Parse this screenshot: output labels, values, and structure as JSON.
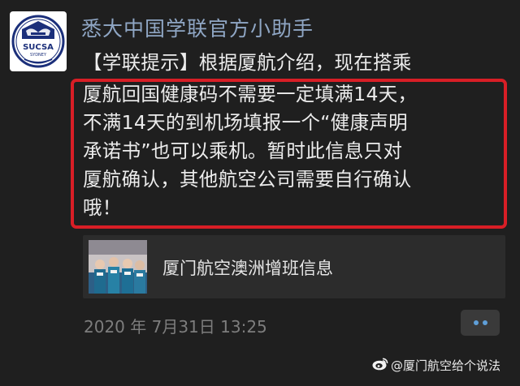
{
  "message": {
    "sender_name": "悉大中国学联官方小助手",
    "avatar": {
      "icon": "sucsa-logo-icon",
      "logo_text": "SUCSA",
      "logo_subtext": "SYDNEY"
    },
    "body_lines": [
      "【学联提示】根据厦航介绍，现在搭乘",
      "厦航回国健康码不需要一定填满14天，",
      "不满14天的到机场填报一个“健康声明",
      "承诺书”也可以乘机。暂时此信息只对",
      "厦航确认，其他航空公司需要自行确认",
      "哦！"
    ],
    "link_card": {
      "title": "厦门航空澳洲增班信息",
      "thumbnail_icon": "flight-attendants-photo-icon"
    },
    "timestamp": "2020 年 7月31日 13:25",
    "more_icon": "more-dots-icon"
  },
  "watermark": {
    "text": "@厦门航空给个说法",
    "icon": "weibo-icon"
  },
  "colors": {
    "background": "#1f1f1f",
    "sender": "#8fa6c4",
    "highlight_border": "#d81e26",
    "card_background": "#2c2c2c",
    "more_dots": "#5f9fd8"
  }
}
